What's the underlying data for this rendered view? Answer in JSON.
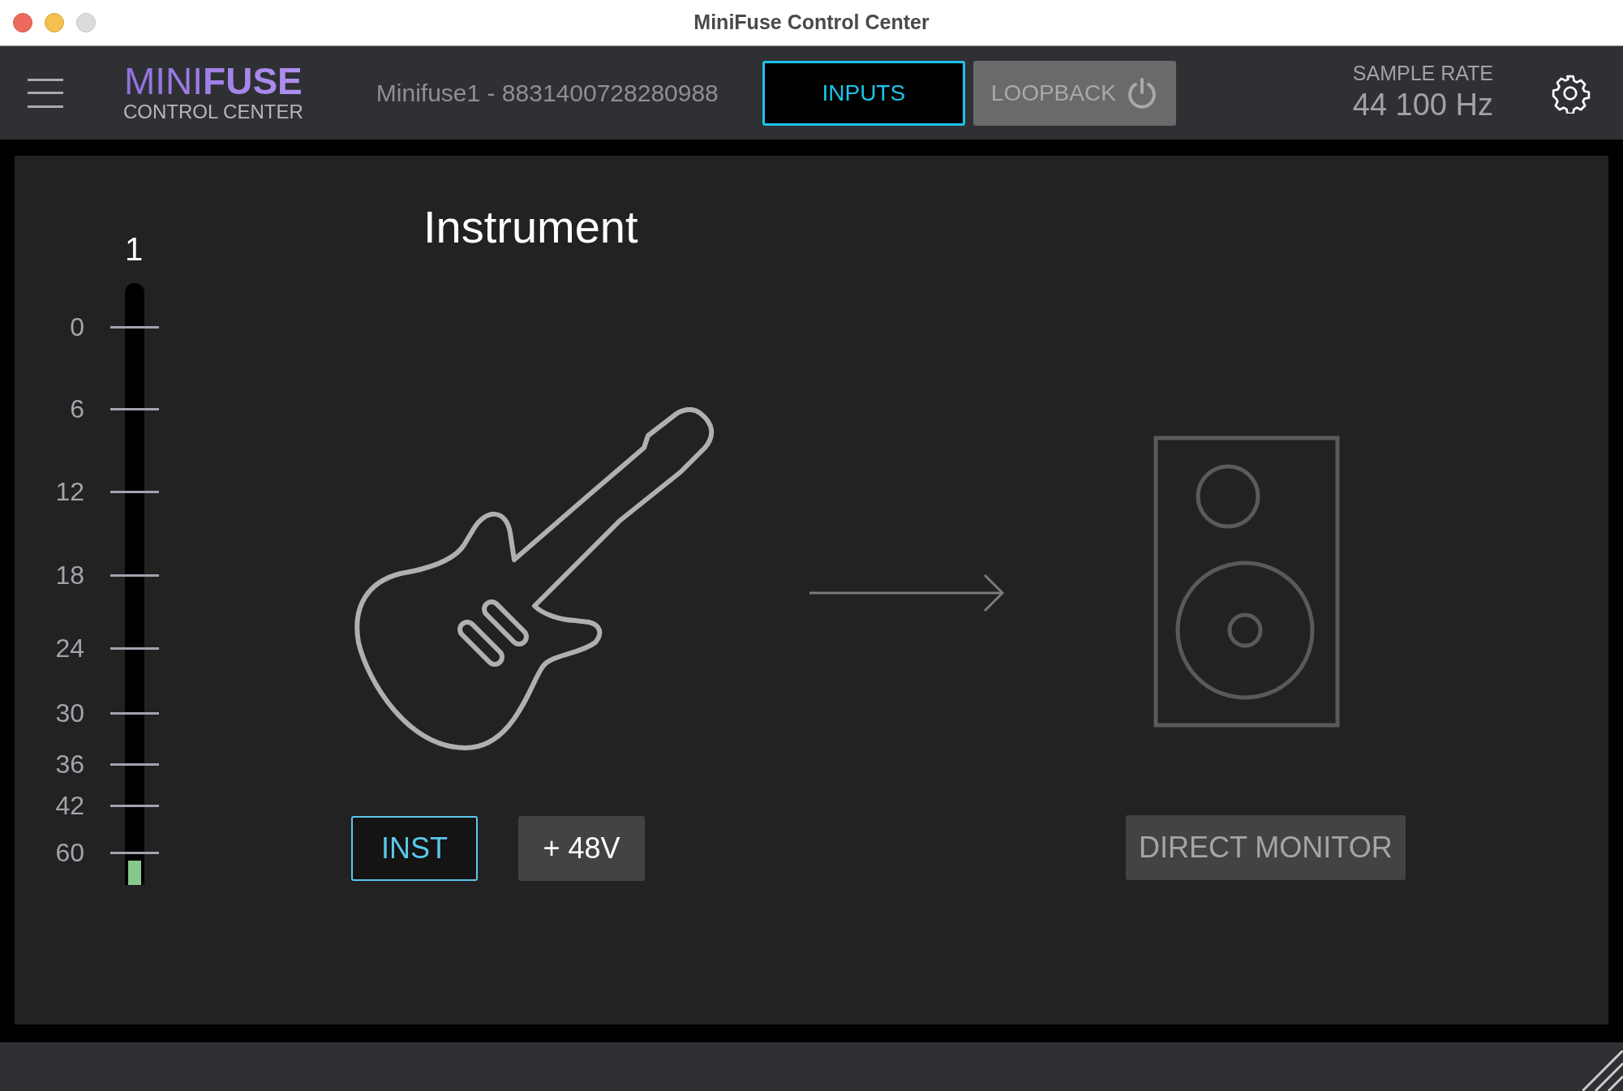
{
  "window": {
    "title": "MiniFuse Control Center"
  },
  "header": {
    "logo": {
      "light": "MINI",
      "bold": "FUSE",
      "subtitle": "CONTROL CENTER"
    },
    "device": "Minifuse1 - 8831400728280988",
    "tabs": [
      {
        "label": "INPUTS",
        "selected": true
      },
      {
        "label": "LOOPBACK",
        "selected": false
      }
    ],
    "sample_rate": {
      "label": "SAMPLE RATE",
      "value": "44 100 Hz"
    }
  },
  "meter": {
    "channel": "1",
    "scale": [
      "0",
      "6",
      "12",
      "18",
      "24",
      "30",
      "36",
      "42",
      "60"
    ],
    "level": 0.04
  },
  "input": {
    "title": "Instrument",
    "buttons": [
      {
        "label": "INST",
        "on": true
      },
      {
        "label": "+ 48V",
        "on": false
      }
    ]
  },
  "output": {
    "buttons": [
      {
        "label": "DIRECT MONITOR",
        "on": false
      }
    ]
  }
}
